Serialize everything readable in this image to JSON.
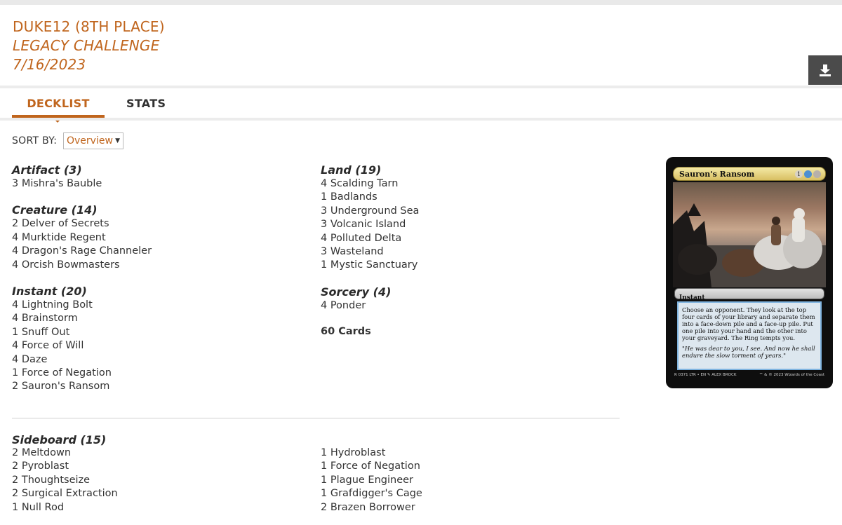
{
  "header": {
    "player": "DUKE12 (8TH PLACE)",
    "event": "LEGACY CHALLENGE",
    "date": "7/16/2023"
  },
  "download_icon": "download-icon",
  "tabs": [
    {
      "label": "DECKLIST",
      "active": true
    },
    {
      "label": "STATS",
      "active": false
    }
  ],
  "sort": {
    "label": "SORT BY:",
    "selected": "Overview"
  },
  "main_left": [
    {
      "title": "Artifact (3)",
      "cards": [
        "3 Mishra's Bauble"
      ]
    },
    {
      "title": "Creature (14)",
      "cards": [
        "2 Delver of Secrets",
        "4 Murktide Regent",
        "4 Dragon's Rage Channeler",
        "4 Orcish Bowmasters"
      ]
    },
    {
      "title": "Instant (20)",
      "cards": [
        "4 Lightning Bolt",
        "4 Brainstorm",
        "1 Snuff Out",
        "4 Force of Will",
        "4 Daze",
        "1 Force of Negation",
        "2 Sauron's Ransom"
      ]
    }
  ],
  "main_right": [
    {
      "title": "Land (19)",
      "cards": [
        "4 Scalding Tarn",
        "1 Badlands",
        "3 Underground Sea",
        "3 Volcanic Island",
        "4 Polluted Delta",
        "3 Wasteland",
        "1 Mystic Sanctuary"
      ]
    },
    {
      "title": "Sorcery (4)",
      "cards": [
        "4 Ponder"
      ]
    }
  ],
  "total": "60 Cards",
  "sideboard": {
    "title": "Sideboard (15)",
    "col_a": [
      "2 Meltdown",
      "2 Pyroblast",
      "2 Thoughtseize",
      "2 Surgical Extraction",
      "1 Null Rod"
    ],
    "col_b": [
      "1 Hydroblast",
      "1 Force of Negation",
      "1 Plague Engineer",
      "1 Grafdigger's Cage",
      "2 Brazen Borrower"
    ]
  },
  "card_preview": {
    "name": "Sauron's Ransom",
    "mana_generic": "1",
    "type_line": "Instant",
    "rules_text": "Choose an opponent. They look at the top four cards of your library and separate them into a face-down pile and a face-up pile. Put one pile into your hand and the other into your graveyard. The Ring tempts you.",
    "flavor_text": "\"He was dear to you, I see. And now he shall endure the slow torment of years.\"",
    "footer_left": "R 0371 LTR • EN ✎ ALEX BROCK",
    "footer_right": "™ & © 2023 Wizards of the Coast"
  },
  "colors": {
    "accent": "#c0651d",
    "text": "#333333",
    "button_dark": "#4b4b4b"
  }
}
